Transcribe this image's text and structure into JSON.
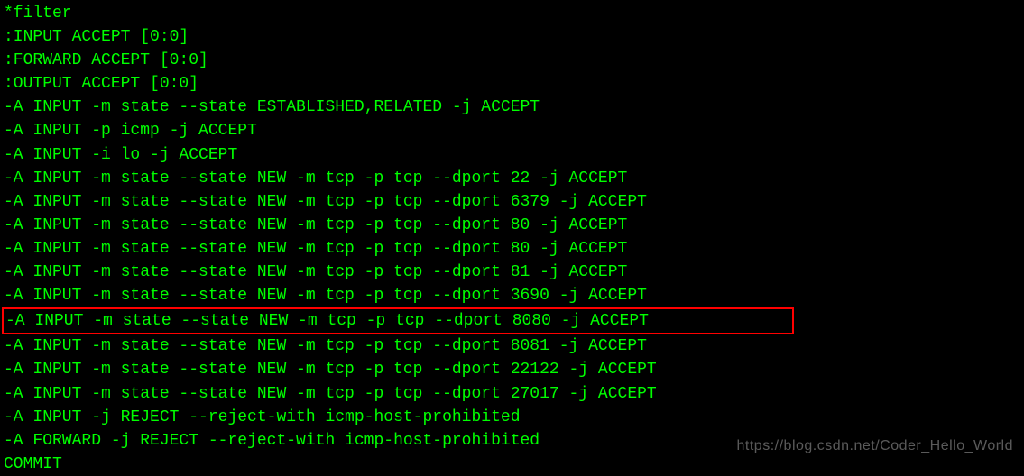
{
  "terminal": {
    "lines": [
      "*filter",
      ":INPUT ACCEPT [0:0]",
      ":FORWARD ACCEPT [0:0]",
      ":OUTPUT ACCEPT [0:0]",
      "-A INPUT -m state --state ESTABLISHED,RELATED -j ACCEPT",
      "-A INPUT -p icmp -j ACCEPT",
      "-A INPUT -i lo -j ACCEPT",
      "-A INPUT -m state --state NEW -m tcp -p tcp --dport 22 -j ACCEPT",
      "-A INPUT -m state --state NEW -m tcp -p tcp --dport 6379 -j ACCEPT",
      "-A INPUT -m state --state NEW -m tcp -p tcp --dport 80 -j ACCEPT",
      "-A INPUT -m state --state NEW -m tcp -p tcp --dport 80 -j ACCEPT",
      "-A INPUT -m state --state NEW -m tcp -p tcp --dport 81 -j ACCEPT",
      "-A INPUT -m state --state NEW -m tcp -p tcp --dport 3690 -j ACCEPT",
      "-A INPUT -m state --state NEW -m tcp -p tcp --dport 8080 -j ACCEPT",
      "-A INPUT -m state --state NEW -m tcp -p tcp --dport 8081 -j ACCEPT",
      "-A INPUT -m state --state NEW -m tcp -p tcp --dport 22122 -j ACCEPT",
      "-A INPUT -m state --state NEW -m tcp -p tcp --dport 27017 -j ACCEPT",
      "-A INPUT -j REJECT --reject-with icmp-host-prohibited",
      "-A FORWARD -j REJECT --reject-with icmp-host-prohibited",
      "COMMIT"
    ],
    "highlighted_index": 13
  },
  "watermark": "https://blog.csdn.net/Coder_Hello_World"
}
